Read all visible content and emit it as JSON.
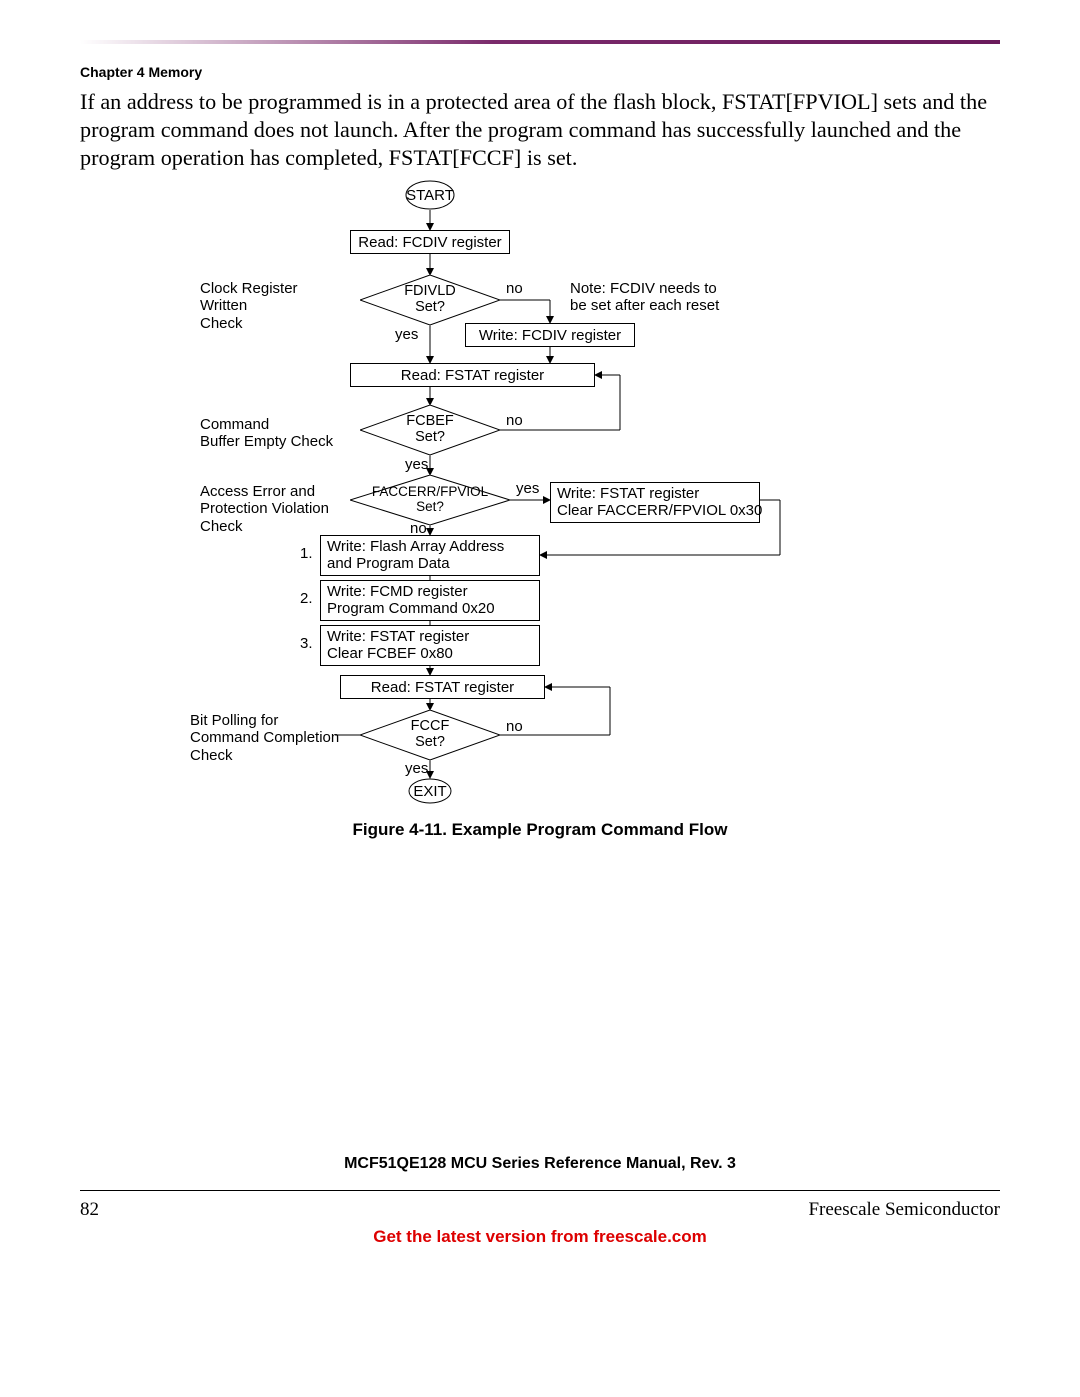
{
  "header": {
    "chapter": "Chapter 4 Memory"
  },
  "paragraph": "If an address to be programmed is in a protected area of the flash block, FSTAT[FPVIOL] sets and the program command does not launch. After the program command has successfully launched and the program operation has completed, FSTAT[FCCF] is set.",
  "flow": {
    "start": "START",
    "read_fcdiv": "Read: FCDIV register",
    "clk_reg_check": "Clock Register\nWritten\nCheck",
    "fdivld": "FDIVLD\nSet?",
    "no1": "no",
    "yes1": "yes",
    "note": "Note: FCDIV needs to\nbe set after each reset",
    "write_fcdiv": "Write: FCDIV register",
    "read_fstat1": "Read: FSTAT register",
    "cmd_buf_check": "Command\nBuffer Empty Check",
    "fcbef": "FCBEF\nSet?",
    "no2": "no",
    "yes2": "yes",
    "access_check": "Access Error and\nProtection Violation\nCheck",
    "faccerr": "FACCERR/FPVIOL\nSet?",
    "yes3": "yes",
    "no3": "no",
    "write_fstat_clear": "Write: FSTAT register\nClear FACCERR/FPVIOL 0x30",
    "n1": "1.",
    "step1": "Write: Flash Array Address\nand Program Data",
    "n2": "2.",
    "step2": "Write: FCMD register\nProgram Command 0x20",
    "n3": "3.",
    "step3": "Write: FSTAT register\nClear FCBEF 0x80",
    "read_fstat2": "Read: FSTAT register",
    "bit_poll": "Bit Polling for\nCommand Completion\nCheck",
    "fccf": "FCCF\nSet?",
    "no4": "no",
    "yes4": "yes",
    "exit": "EXIT"
  },
  "figcap": "Figure 4-11. Example Program Command Flow",
  "footer": {
    "center": "MCF51QE128 MCU Series Reference Manual, Rev. 3",
    "page": "82",
    "right": "Freescale Semiconductor",
    "link": "Get the latest version from freescale.com"
  }
}
